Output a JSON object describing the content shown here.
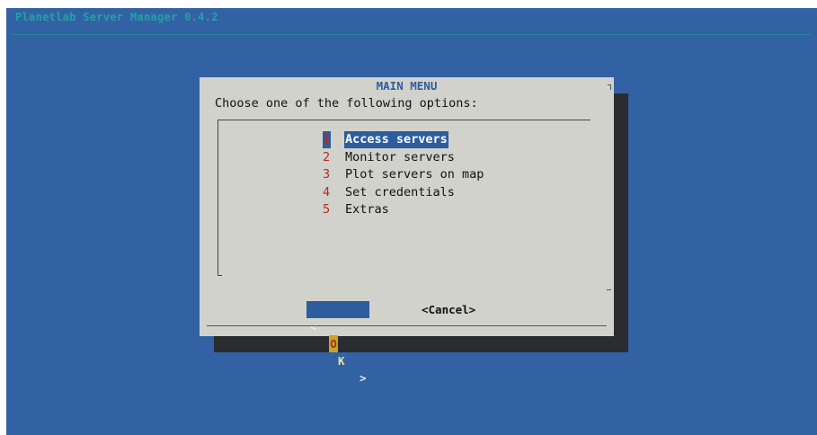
{
  "app": {
    "backtitle": "Planetlab Server Manager 0.4.2"
  },
  "dialog": {
    "title": "MAIN MENU",
    "prompt": "Choose one of the following options:",
    "items": [
      {
        "tag": "1",
        "label": "Access servers",
        "selected": true
      },
      {
        "tag": "2",
        "label": "Monitor servers",
        "selected": false
      },
      {
        "tag": "3",
        "label": "Plot servers on map",
        "selected": false
      },
      {
        "tag": "4",
        "label": "Set credentials",
        "selected": false
      },
      {
        "tag": "5",
        "label": "Extras",
        "selected": false
      }
    ],
    "buttons": {
      "ok_left": "<",
      "ok_hotkey": "O",
      "ok_rest": "K",
      "ok_right": ">",
      "cancel": "<Cancel>"
    }
  },
  "colors": {
    "background": "#3262a4",
    "dialog": "#d2d2cc",
    "shadow": "#2a2c2f",
    "highlight": "#2d5d9f",
    "tag": "#b22b22",
    "backtitle": "#1fa3a3"
  }
}
